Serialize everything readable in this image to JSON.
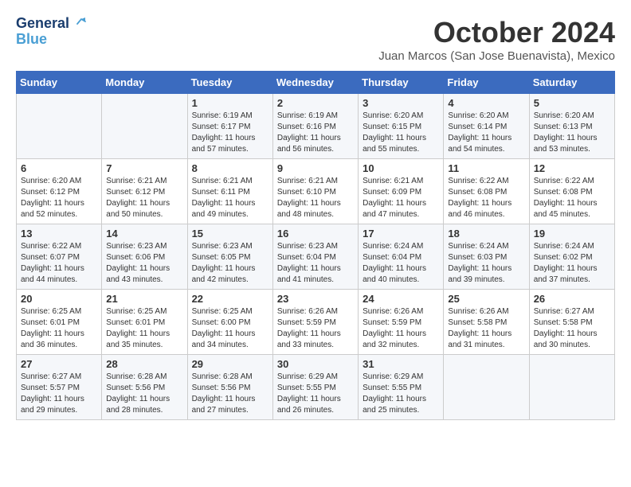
{
  "logo": {
    "text1": "General",
    "text2": "Blue"
  },
  "title": "October 2024",
  "subtitle": "Juan Marcos (San Jose Buenavista), Mexico",
  "weekdays": [
    "Sunday",
    "Monday",
    "Tuesday",
    "Wednesday",
    "Thursday",
    "Friday",
    "Saturday"
  ],
  "weeks": [
    [
      {
        "day": "",
        "info": ""
      },
      {
        "day": "",
        "info": ""
      },
      {
        "day": "1",
        "info": "Sunrise: 6:19 AM\nSunset: 6:17 PM\nDaylight: 11 hours and 57 minutes."
      },
      {
        "day": "2",
        "info": "Sunrise: 6:19 AM\nSunset: 6:16 PM\nDaylight: 11 hours and 56 minutes."
      },
      {
        "day": "3",
        "info": "Sunrise: 6:20 AM\nSunset: 6:15 PM\nDaylight: 11 hours and 55 minutes."
      },
      {
        "day": "4",
        "info": "Sunrise: 6:20 AM\nSunset: 6:14 PM\nDaylight: 11 hours and 54 minutes."
      },
      {
        "day": "5",
        "info": "Sunrise: 6:20 AM\nSunset: 6:13 PM\nDaylight: 11 hours and 53 minutes."
      }
    ],
    [
      {
        "day": "6",
        "info": "Sunrise: 6:20 AM\nSunset: 6:12 PM\nDaylight: 11 hours and 52 minutes."
      },
      {
        "day": "7",
        "info": "Sunrise: 6:21 AM\nSunset: 6:12 PM\nDaylight: 11 hours and 50 minutes."
      },
      {
        "day": "8",
        "info": "Sunrise: 6:21 AM\nSunset: 6:11 PM\nDaylight: 11 hours and 49 minutes."
      },
      {
        "day": "9",
        "info": "Sunrise: 6:21 AM\nSunset: 6:10 PM\nDaylight: 11 hours and 48 minutes."
      },
      {
        "day": "10",
        "info": "Sunrise: 6:21 AM\nSunset: 6:09 PM\nDaylight: 11 hours and 47 minutes."
      },
      {
        "day": "11",
        "info": "Sunrise: 6:22 AM\nSunset: 6:08 PM\nDaylight: 11 hours and 46 minutes."
      },
      {
        "day": "12",
        "info": "Sunrise: 6:22 AM\nSunset: 6:08 PM\nDaylight: 11 hours and 45 minutes."
      }
    ],
    [
      {
        "day": "13",
        "info": "Sunrise: 6:22 AM\nSunset: 6:07 PM\nDaylight: 11 hours and 44 minutes."
      },
      {
        "day": "14",
        "info": "Sunrise: 6:23 AM\nSunset: 6:06 PM\nDaylight: 11 hours and 43 minutes."
      },
      {
        "day": "15",
        "info": "Sunrise: 6:23 AM\nSunset: 6:05 PM\nDaylight: 11 hours and 42 minutes."
      },
      {
        "day": "16",
        "info": "Sunrise: 6:23 AM\nSunset: 6:04 PM\nDaylight: 11 hours and 41 minutes."
      },
      {
        "day": "17",
        "info": "Sunrise: 6:24 AM\nSunset: 6:04 PM\nDaylight: 11 hours and 40 minutes."
      },
      {
        "day": "18",
        "info": "Sunrise: 6:24 AM\nSunset: 6:03 PM\nDaylight: 11 hours and 39 minutes."
      },
      {
        "day": "19",
        "info": "Sunrise: 6:24 AM\nSunset: 6:02 PM\nDaylight: 11 hours and 37 minutes."
      }
    ],
    [
      {
        "day": "20",
        "info": "Sunrise: 6:25 AM\nSunset: 6:01 PM\nDaylight: 11 hours and 36 minutes."
      },
      {
        "day": "21",
        "info": "Sunrise: 6:25 AM\nSunset: 6:01 PM\nDaylight: 11 hours and 35 minutes."
      },
      {
        "day": "22",
        "info": "Sunrise: 6:25 AM\nSunset: 6:00 PM\nDaylight: 11 hours and 34 minutes."
      },
      {
        "day": "23",
        "info": "Sunrise: 6:26 AM\nSunset: 5:59 PM\nDaylight: 11 hours and 33 minutes."
      },
      {
        "day": "24",
        "info": "Sunrise: 6:26 AM\nSunset: 5:59 PM\nDaylight: 11 hours and 32 minutes."
      },
      {
        "day": "25",
        "info": "Sunrise: 6:26 AM\nSunset: 5:58 PM\nDaylight: 11 hours and 31 minutes."
      },
      {
        "day": "26",
        "info": "Sunrise: 6:27 AM\nSunset: 5:58 PM\nDaylight: 11 hours and 30 minutes."
      }
    ],
    [
      {
        "day": "27",
        "info": "Sunrise: 6:27 AM\nSunset: 5:57 PM\nDaylight: 11 hours and 29 minutes."
      },
      {
        "day": "28",
        "info": "Sunrise: 6:28 AM\nSunset: 5:56 PM\nDaylight: 11 hours and 28 minutes."
      },
      {
        "day": "29",
        "info": "Sunrise: 6:28 AM\nSunset: 5:56 PM\nDaylight: 11 hours and 27 minutes."
      },
      {
        "day": "30",
        "info": "Sunrise: 6:29 AM\nSunset: 5:55 PM\nDaylight: 11 hours and 26 minutes."
      },
      {
        "day": "31",
        "info": "Sunrise: 6:29 AM\nSunset: 5:55 PM\nDaylight: 11 hours and 25 minutes."
      },
      {
        "day": "",
        "info": ""
      },
      {
        "day": "",
        "info": ""
      }
    ]
  ]
}
